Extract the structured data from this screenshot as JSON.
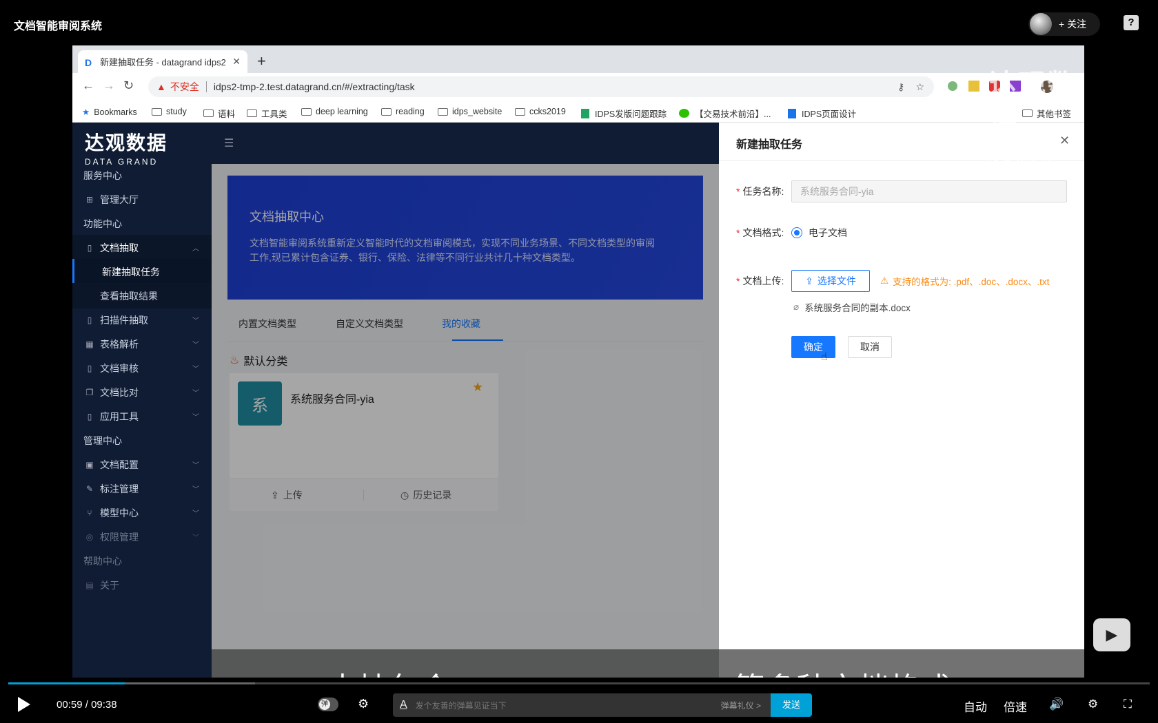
{
  "page_title": "文档智能审阅系统",
  "follow_label": "+ 关注",
  "help_icon": "?",
  "browser": {
    "tab_title": "新建抽取任务 - datagrand idps2",
    "new_tab": "+",
    "insecure_label": "不安全",
    "url": "idps2-tmp-2.test.datagrand.cn/#/extracting/task",
    "bookmarks": [
      "Bookmarks",
      "study",
      "语料",
      "工具类",
      "deep learning",
      "reading",
      "idps_website",
      "ccks2019",
      "IDPS发版问题跟踪",
      "【交易技术前沿】...",
      "IDPS页面设计",
      "其他书签"
    ]
  },
  "logo": {
    "cn": "达观数据",
    "en": "DATA GRAND"
  },
  "sidebar": {
    "items": [
      {
        "label": "服务中心"
      },
      {
        "label": "管理大厅"
      },
      {
        "label": "功能中心"
      },
      {
        "label": "文档抽取"
      },
      {
        "label": "新建抽取任务"
      },
      {
        "label": "查看抽取结果"
      },
      {
        "label": "扫描件抽取"
      },
      {
        "label": "表格解析"
      },
      {
        "label": "文档审核"
      },
      {
        "label": "文档比对"
      },
      {
        "label": "应用工具"
      },
      {
        "label": "管理中心"
      },
      {
        "label": "文档配置"
      },
      {
        "label": "标注管理"
      },
      {
        "label": "模型中心"
      },
      {
        "label": "权限管理"
      },
      {
        "label": "帮助中心"
      },
      {
        "label": "关于"
      }
    ]
  },
  "banner": {
    "title": "文档抽取中心",
    "desc": "文档智能审阅系统重新定义智能时代的文档审阅模式，实现不同业务场景、不同文档类型的审阅工作,现已累计包含证券、银行、保险、法律等不同行业共计几十种文档类型。"
  },
  "content_tabs": [
    "内置文档类型",
    "自定义文档类型",
    "我的收藏"
  ],
  "section_title": "默认分类",
  "card": {
    "avatar": "系",
    "title": "系统服务合同-yia",
    "upload": "上传",
    "history": "历史记录"
  },
  "drawer": {
    "title": "新建抽取任务",
    "name_label": "任务名称:",
    "name_value": "系统服务合同-yia",
    "format_label": "文档格式:",
    "format_option": "电子文档",
    "upload_label": "文档上传:",
    "upload_button": "选择文件",
    "format_hint": "支持的格式为: .pdf、.doc、.docx、.txt",
    "file_name": "系统服务合同的副本.docx",
    "ok_label": "确定",
    "cancel_label": "取消"
  },
  "subtitle": "支持包含WORD、PDF、TXT等多种文档格式",
  "watermark": {
    "cn": "达观数据",
    "en": "DATA GRAND"
  },
  "player": {
    "current_time": "00:59",
    "separator": "/",
    "total_time": "09:38",
    "danmaku_toggle": "弹",
    "danmaku_placeholder": "发个友善的弹幕见证当下",
    "danmaku_gift": "弹幕礼仪 >",
    "send_label": "发送",
    "auto_label": "自动",
    "speed_label": "倍速",
    "progress_fraction": 0.102
  }
}
